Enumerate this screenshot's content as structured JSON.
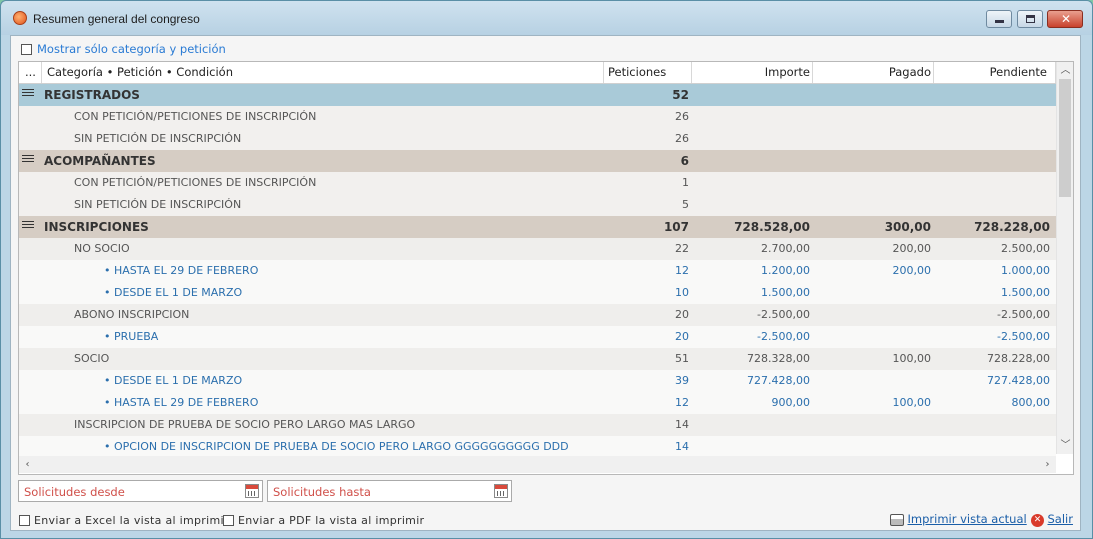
{
  "window": {
    "title": "Resumen general del congreso"
  },
  "filter": {
    "label": "Mostrar sólo categoría y petición",
    "checked": false
  },
  "table": {
    "columns": {
      "menu": "...",
      "name": "Categoría • Petición • Condición",
      "pet": "Peticiones",
      "imp": "Importe",
      "pag": "Pagado",
      "pen": "Pendiente"
    },
    "rows": [
      {
        "level": 1,
        "name": "REGISTRADOS",
        "pet": "52",
        "imp": "",
        "pag": "",
        "pen": "",
        "bg": "#a9cad8"
      },
      {
        "level": 2,
        "name": "CON PETICIÓN/PETICIONES DE INSCRIPCIÓN",
        "pet": "26",
        "imp": "",
        "pag": "",
        "pen": "",
        "bg": "#f2f0ee"
      },
      {
        "level": 2,
        "name": "SIN PETICIÓN DE INSCRIPCIÓN",
        "pet": "26",
        "imp": "",
        "pag": "",
        "pen": "",
        "bg": "#f2f0ee"
      },
      {
        "level": 1,
        "name": "ACOMPAÑANTES",
        "pet": "6",
        "imp": "",
        "pag": "",
        "pen": "",
        "bg": "#d6cdc4"
      },
      {
        "level": 2,
        "name": "CON PETICIÓN/PETICIONES DE INSCRIPCIÓN",
        "pet": "1",
        "imp": "",
        "pag": "",
        "pen": "",
        "bg": "#f2f0ee"
      },
      {
        "level": 2,
        "name": "SIN PETICIÓN DE INSCRIPCIÓN",
        "pet": "5",
        "imp": "",
        "pag": "",
        "pen": "",
        "bg": "#f2f0ee"
      },
      {
        "level": 1,
        "name": "INSCRIPCIONES",
        "pet": "107",
        "imp": "728.528,00",
        "pag": "300,00",
        "pen": "728.228,00",
        "bg": "#d6cdc4"
      },
      {
        "level": 2,
        "name": "NO SOCIO",
        "pet": "22",
        "imp": "2.700,00",
        "pag": "200,00",
        "pen": "2.500,00",
        "bg": "#efeeec"
      },
      {
        "level": 3,
        "name": "• HASTA EL 29 DE FEBRERO",
        "pet": "12",
        "imp": "1.200,00",
        "pag": "200,00",
        "pen": "1.000,00",
        "bg": "#f9f9f8"
      },
      {
        "level": 3,
        "name": "• DESDE EL 1 DE MARZO",
        "pet": "10",
        "imp": "1.500,00",
        "pag": "",
        "pen": "1.500,00",
        "bg": "#f9f9f8"
      },
      {
        "level": 2,
        "name": "ABONO INSCRIPCION",
        "pet": "20",
        "imp": "-2.500,00",
        "pag": "",
        "pen": "-2.500,00",
        "bg": "#efeeec"
      },
      {
        "level": 3,
        "name": "• PRUEBA",
        "pet": "20",
        "imp": "-2.500,00",
        "pag": "",
        "pen": "-2.500,00",
        "bg": "#f9f9f8"
      },
      {
        "level": 2,
        "name": "SOCIO",
        "pet": "51",
        "imp": "728.328,00",
        "pag": "100,00",
        "pen": "728.228,00",
        "bg": "#efeeec"
      },
      {
        "level": 3,
        "name": "• DESDE EL 1 DE MARZO",
        "pet": "39",
        "imp": "727.428,00",
        "pag": "",
        "pen": "727.428,00",
        "bg": "#f9f9f8"
      },
      {
        "level": 3,
        "name": "• HASTA EL 29 DE FEBRERO",
        "pet": "12",
        "imp": "900,00",
        "pag": "100,00",
        "pen": "800,00",
        "bg": "#f9f9f8"
      },
      {
        "level": 2,
        "name": "INSCRIPCION DE PRUEBA DE SOCIO PERO LARGO MAS LARGO",
        "pet": "14",
        "imp": "",
        "pag": "",
        "pen": "",
        "bg": "#efeeec"
      },
      {
        "level": 3,
        "name": "• OPCION DE INSCRIPCION DE PRUEBA DE SOCIO PERO LARGO GGGGGGGGGG DDD",
        "pet": "14",
        "imp": "",
        "pag": "",
        "pen": "",
        "bg": "#f9f9f8"
      }
    ]
  },
  "dates": {
    "from_placeholder": "Solicitudes desde",
    "to_placeholder": "Solicitudes hasta"
  },
  "footer": {
    "excel_label": "Enviar a Excel la vista al imprimir",
    "pdf_label": "Enviar a PDF la vista al imprimir",
    "print_label": "Imprimir vista actual",
    "exit_label": "Salir"
  }
}
